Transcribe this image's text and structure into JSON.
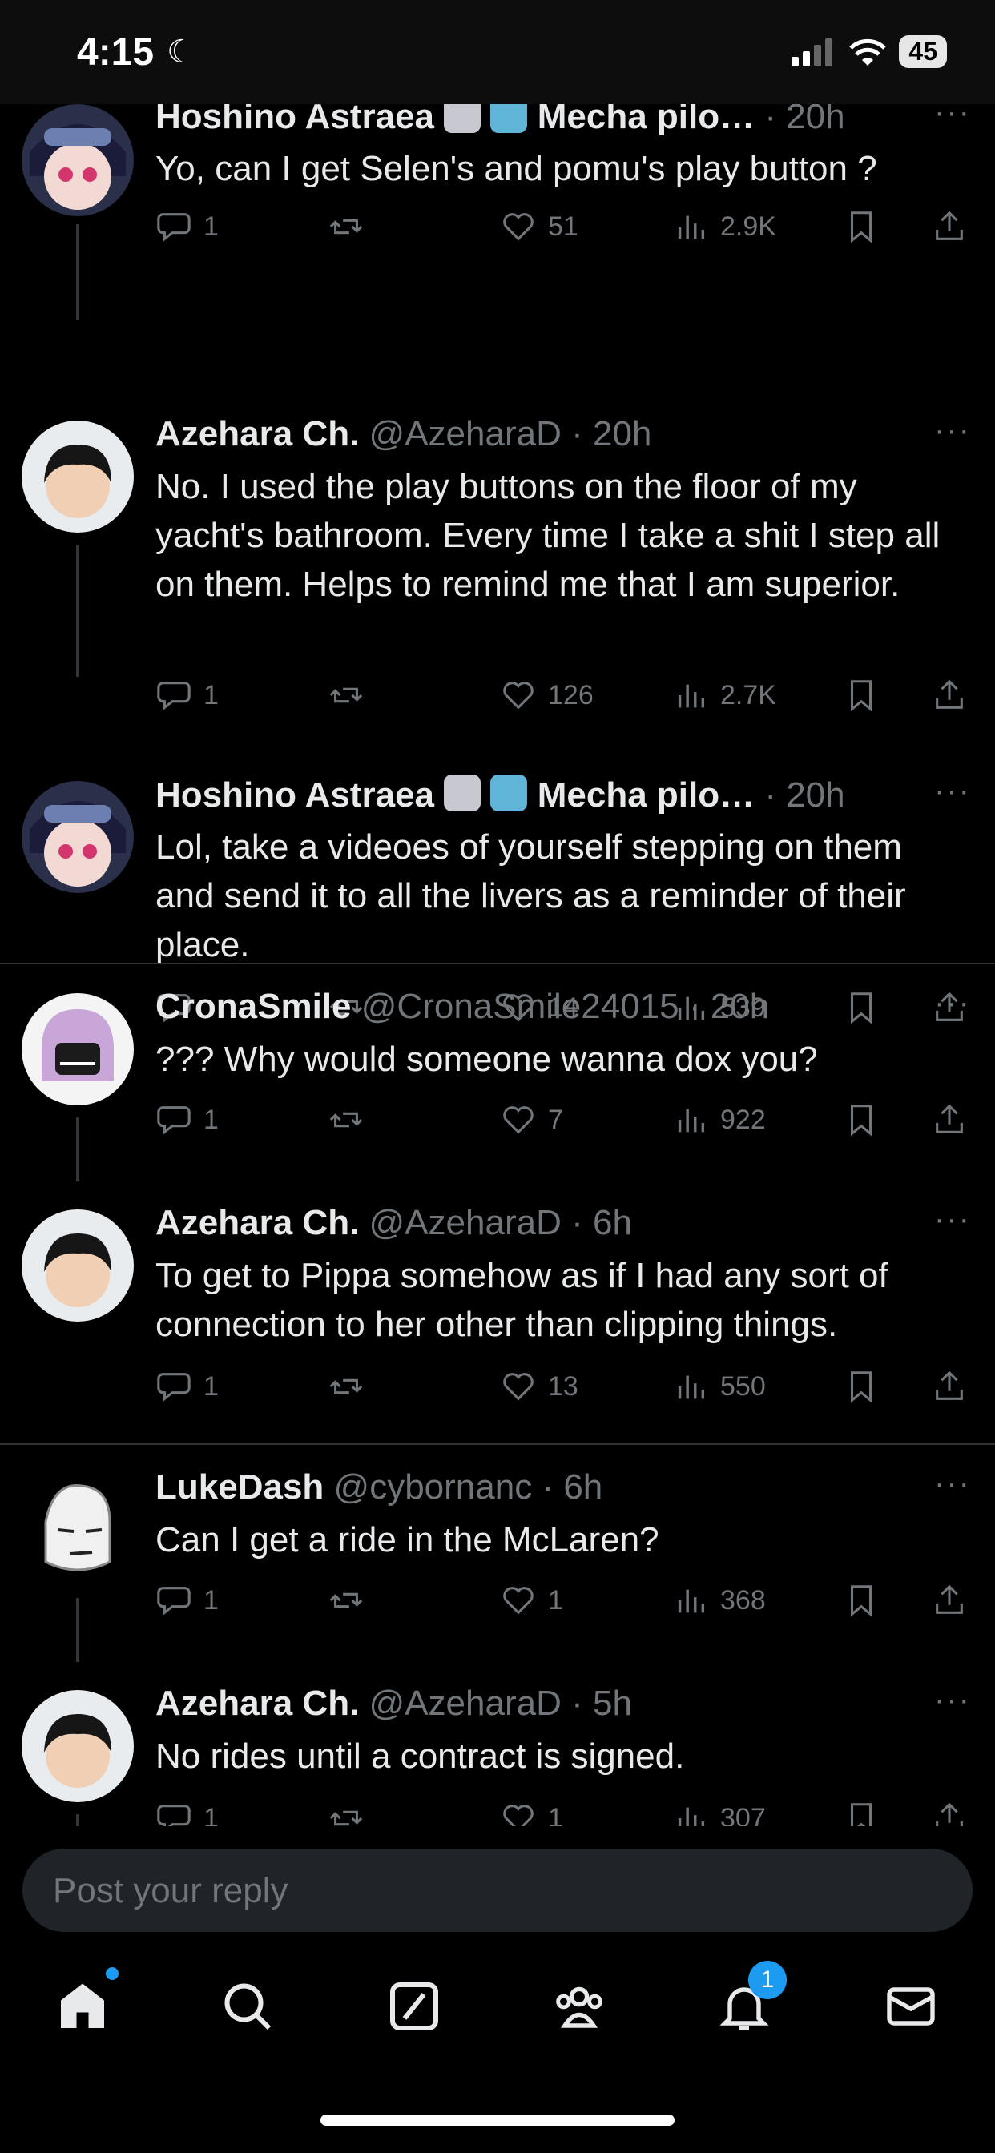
{
  "status_bar": {
    "time": "4:15",
    "battery": "45"
  },
  "tweets": [
    {
      "name": "Hoshino Astraea",
      "name_suffix": "Mecha pilo…",
      "handle": "",
      "time": "· 20h",
      "text": "Yo, can I  get Selen's and pomu's play button ?",
      "replies": "1",
      "reposts": "",
      "likes": "51",
      "views": "2.9K"
    },
    {
      "name": "Azehara Ch.",
      "name_suffix": "",
      "handle": "@AzeharaD",
      "time": "· 20h",
      "text": "No.  I used the play buttons on the floor of my yacht's bathroom.  Every time I take a shit I step all on them.  Helps to remind me that I am superior.",
      "replies": "1",
      "reposts": "",
      "likes": "126",
      "views": "2.7K"
    },
    {
      "name": "Hoshino Astraea",
      "name_suffix": "Mecha pilo…",
      "handle": "",
      "time": "· 20h",
      "text": "Lol, take a videoes of yourself stepping on them and send it to all the livers as a reminder of their place.",
      "replies": "",
      "reposts": "",
      "likes": "14",
      "views": "539"
    },
    {
      "name": "CronaSmile",
      "name_suffix": "",
      "handle": "@CronaSmile24015",
      "time": "· 20h",
      "text": "??? Why would someone wanna dox you?",
      "replies": "1",
      "reposts": "",
      "likes": "7",
      "views": "922"
    },
    {
      "name": "Azehara Ch.",
      "name_suffix": "",
      "handle": "@AzeharaD",
      "time": "· 6h",
      "text": "To get to Pippa somehow as if I had any sort of connection to her other than clipping things.",
      "replies": "1",
      "reposts": "",
      "likes": "13",
      "views": "550"
    },
    {
      "name": "LukeDash",
      "name_suffix": "",
      "handle": "@cybornanc",
      "time": "· 6h",
      "text": "Can I get a ride in the McLaren?",
      "replies": "1",
      "reposts": "",
      "likes": "1",
      "views": "368"
    },
    {
      "name": "Azehara Ch.",
      "name_suffix": "",
      "handle": "@AzeharaD",
      "time": "· 5h",
      "text": "No rides until a contract is signed.",
      "replies": "1",
      "reposts": "",
      "likes": "1",
      "views": "307"
    }
  ],
  "reply": {
    "placeholder": "Post your reply"
  },
  "tabbar": {
    "notifications_badge": "1"
  },
  "colors": {
    "accent": "#1d9bf0",
    "muted": "#71767b",
    "text": "#e7e9ea",
    "background": "#000000"
  },
  "icons": [
    "home-icon",
    "search-icon",
    "grok-icon",
    "communities-icon",
    "bell-icon",
    "mail-icon",
    "reply-icon",
    "repost-icon",
    "like-icon",
    "views-icon",
    "bookmark-icon",
    "share-icon"
  ]
}
